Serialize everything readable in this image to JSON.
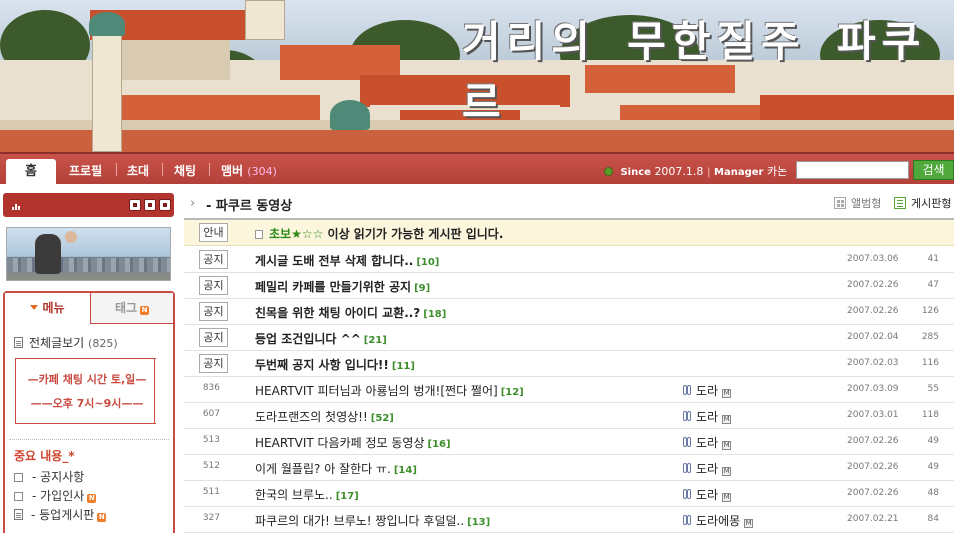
{
  "banner": {
    "title": "거리의 무한질주 파쿠르"
  },
  "nav": {
    "home": "홈",
    "items": [
      {
        "label": "프로필"
      },
      {
        "label": "초대"
      },
      {
        "label": "채팅"
      },
      {
        "label": "맴버",
        "count": "(304)"
      }
    ],
    "since_label": "Since",
    "since_value": "2007.1.8",
    "manager_label": "Manager",
    "manager_value": "카논",
    "search_placeholder": "",
    "search_button": "검색"
  },
  "sidebar": {
    "tabs": {
      "menu": "메뉴",
      "tag": "태그",
      "tag_badge": "N"
    },
    "all_posts": {
      "label": "전체글보기",
      "count": "(825)"
    },
    "notice_lines": [
      "카페 채팅 시간 토,일",
      "오후 7시~9시"
    ],
    "important_title": "중요 내용_*",
    "items": [
      {
        "label": "- 공지사항",
        "badge": ""
      },
      {
        "label": "- 가입인사",
        "badge": "N"
      },
      {
        "label": "- 등업게시판",
        "badge": "N"
      }
    ]
  },
  "board": {
    "title": "- 파쿠르 동영상",
    "view_album": "앨범형",
    "view_list": "게시판형",
    "guide": {
      "tag": "안내",
      "prefix": "초보",
      "stars": "★☆☆",
      "text": " 이상 읽기가 가능한 게시판 입니다."
    },
    "notices": [
      {
        "tag": "공지",
        "subject": "게시글 도배 전부 삭제 합니다..",
        "comments": "[10]",
        "date": "2007.03.06",
        "views": "41"
      },
      {
        "tag": "공지",
        "subject": "페밀리 카페를 만들기위한 공지",
        "comments": "[9]",
        "date": "2007.02.26",
        "views": "47"
      },
      {
        "tag": "공지",
        "subject": "친목을 위한 채팅 아이디 교환..?",
        "comments": "[18]",
        "date": "2007.02.26",
        "views": "126"
      },
      {
        "tag": "공지",
        "subject": "등업 조건입니다 ^^",
        "comments": "[21]",
        "date": "2007.02.04",
        "views": "285"
      },
      {
        "tag": "공지",
        "subject": "두번째 공지 사항 입니다!!",
        "comments": "[11]",
        "date": "2007.02.03",
        "views": "116"
      }
    ],
    "posts": [
      {
        "num": "836",
        "subject": "HEARTVIT 피터님과 아룡님의 벙개![쩐다 쩔어]",
        "comments": "[12]",
        "author": "도라",
        "date": "2007.03.09",
        "views": "55"
      },
      {
        "num": "607",
        "subject": "도라프랜즈의 첫영상!!",
        "comments": "[52]",
        "author": "도라",
        "date": "2007.03.01",
        "views": "118"
      },
      {
        "num": "513",
        "subject": "HEARTVIT 다음카페 정모 동영상",
        "comments": "[16]",
        "author": "도라",
        "date": "2007.02.26",
        "views": "49"
      },
      {
        "num": "512",
        "subject": "이게 월플립? 아 잘한다 ㅠ.",
        "comments": "[14]",
        "author": "도라",
        "date": "2007.02.26",
        "views": "49"
      },
      {
        "num": "511",
        "subject": "한국의 브루노..",
        "comments": "[17]",
        "author": "도라",
        "date": "2007.02.26",
        "views": "48"
      },
      {
        "num": "327",
        "subject": "파쿠르의 대가! 브루노! 짱입니다 후덜덜..",
        "comments": "[13]",
        "author": "도라에몽",
        "date": "2007.02.21",
        "views": "84"
      }
    ]
  },
  "colors": {
    "brand_red": "#b1352e",
    "accent_green": "#4ea83a",
    "comment_green": "#3c8f2a"
  }
}
